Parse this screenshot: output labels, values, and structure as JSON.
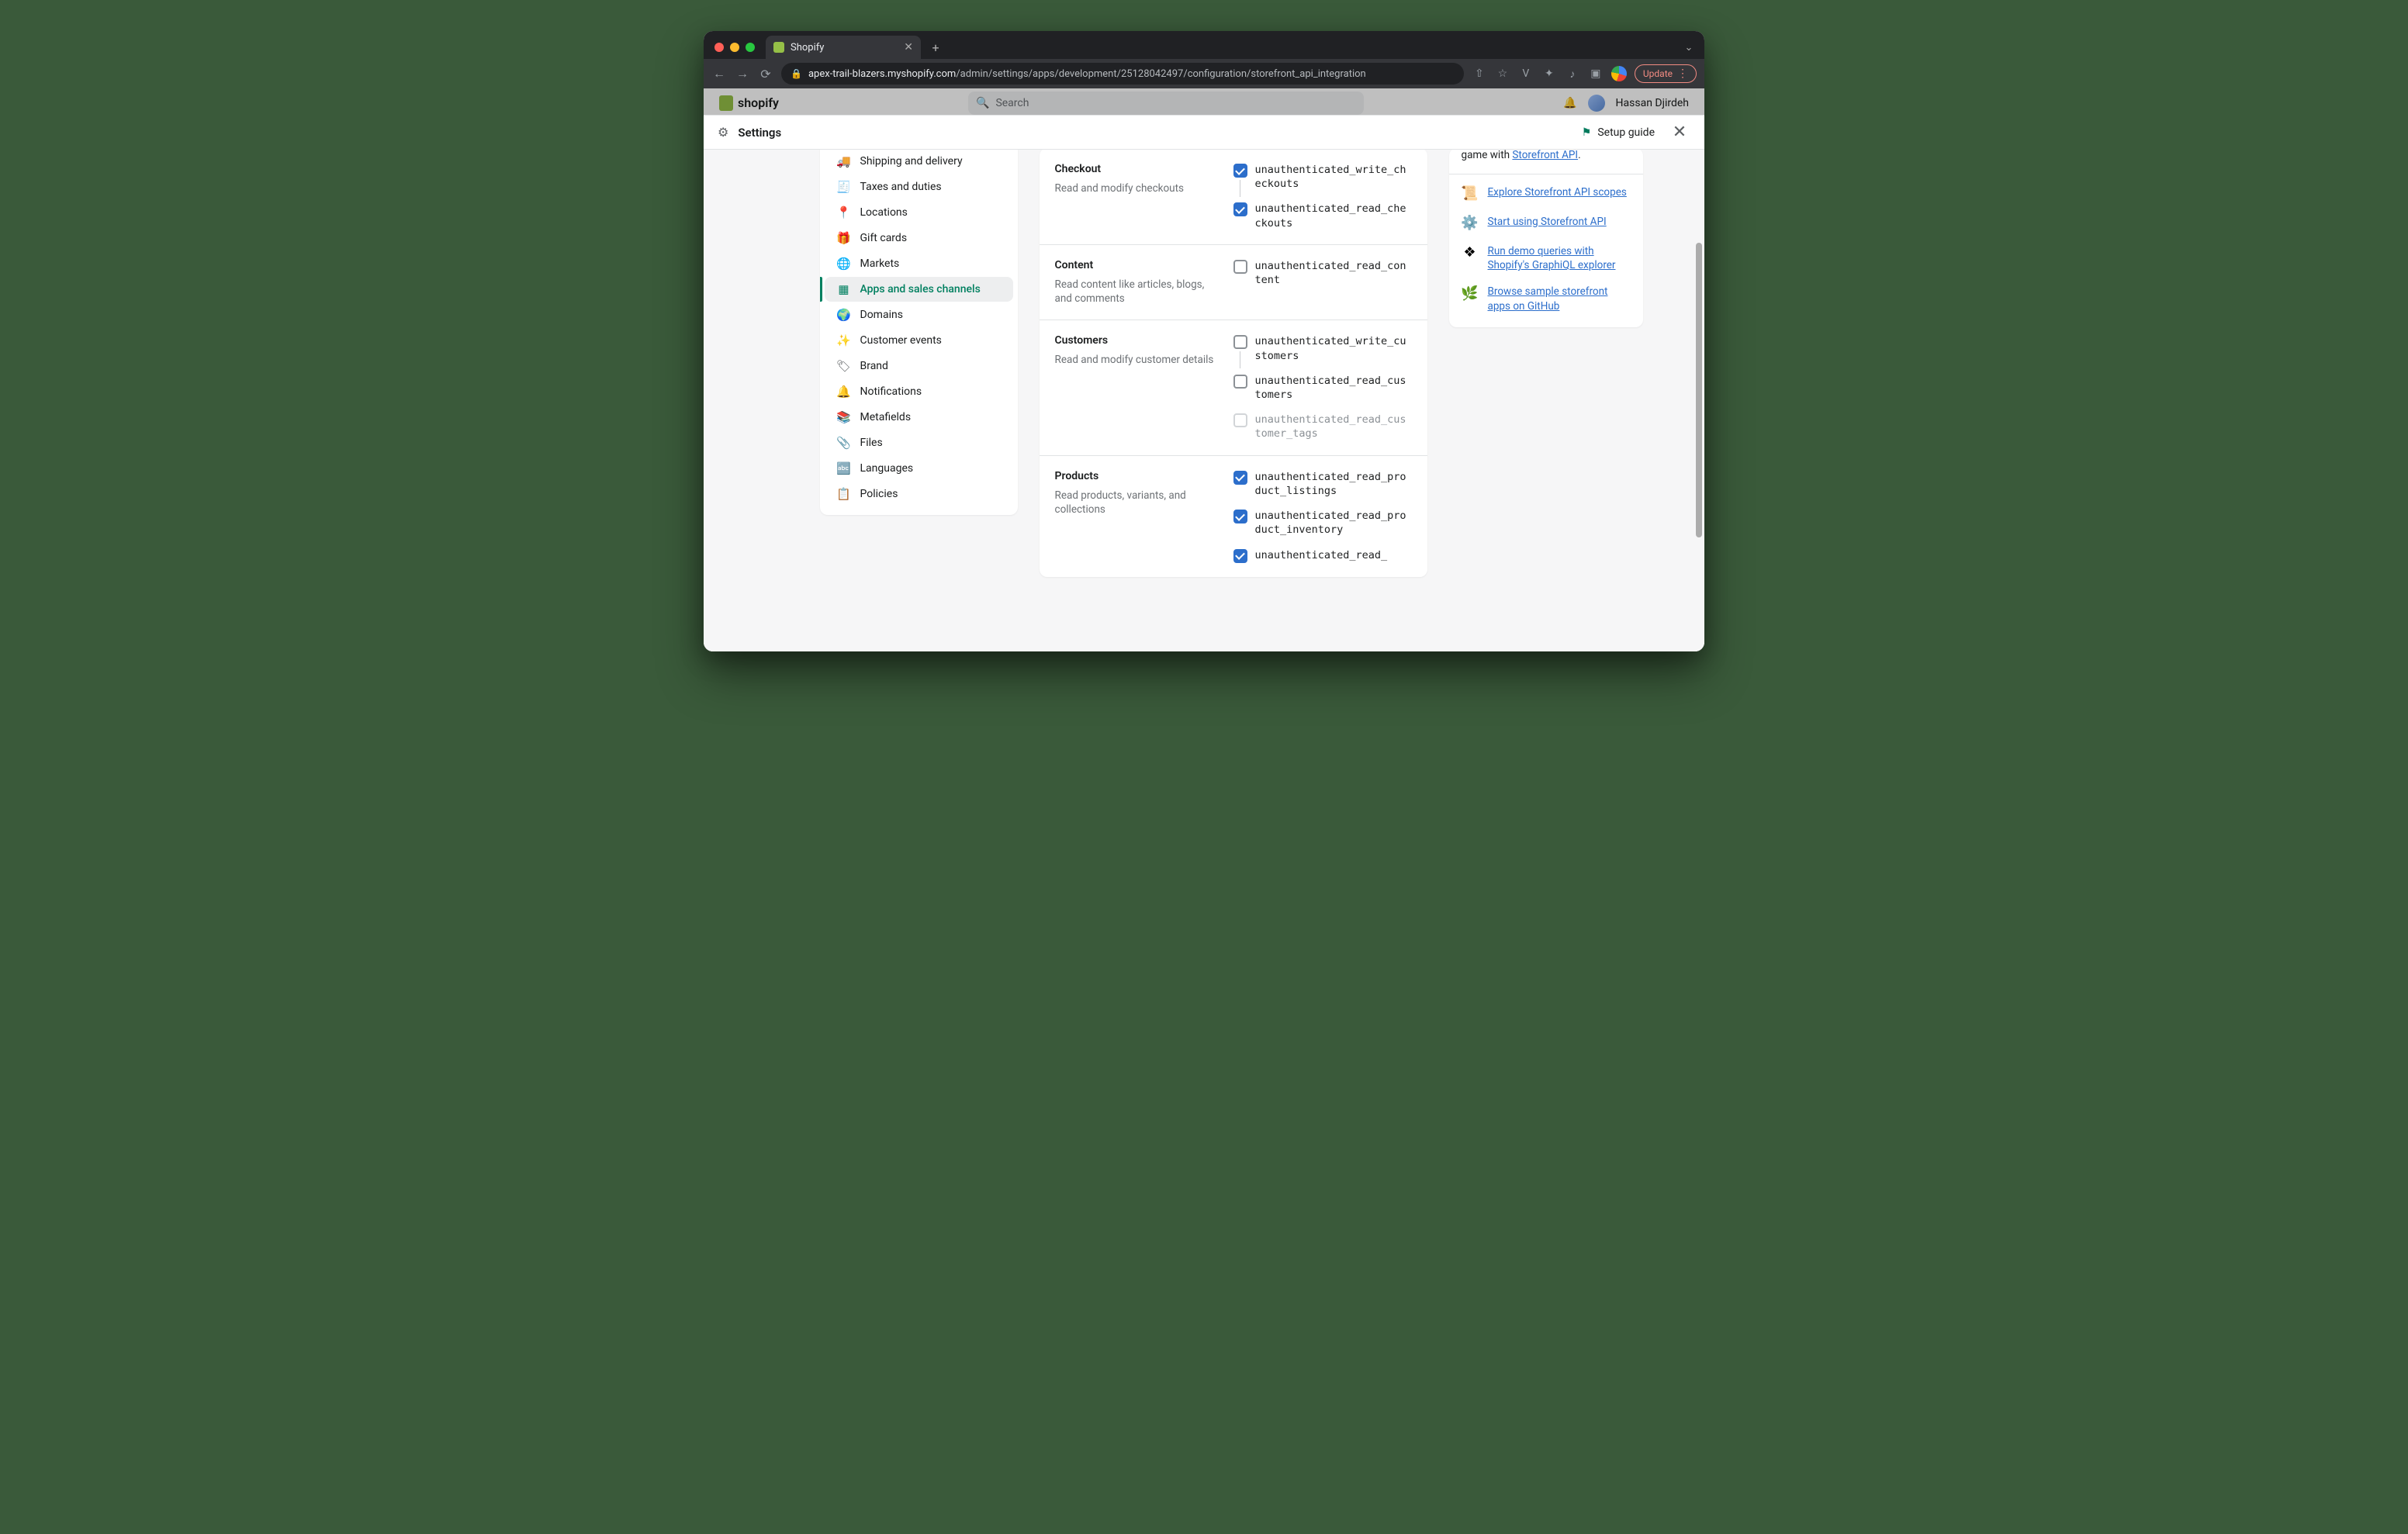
{
  "browser": {
    "tab_title": "Shopify",
    "new_tab_glyph": "+",
    "dropdown_glyph": "⌄",
    "back_glyph": "←",
    "forward_glyph": "→",
    "reload_glyph": "⟳",
    "lock_glyph": "🔒",
    "url_host": "apex-trail-blazers.myshopify.com",
    "url_path": "/admin/settings/apps/development/25128042497/configuration/storefront_api_integration",
    "share_glyph": "⇧",
    "star_glyph": "☆",
    "v_glyph": "V",
    "puzzle_glyph": "✦",
    "music_glyph": "♪",
    "square_glyph": "▣",
    "update_label": "Update"
  },
  "shopify_header": {
    "logo_text": "shopify",
    "search_placeholder": "Search",
    "search_glyph": "🔍",
    "bell_glyph": "🔔",
    "user_name": "Hassan Djirdeh"
  },
  "modal": {
    "gear_glyph": "⚙",
    "title": "Settings",
    "setup_flag_glyph": "⚑",
    "setup_label": "Setup guide",
    "close_glyph": "✕"
  },
  "sidebar": {
    "items": [
      {
        "icon": "🚚",
        "label": "Shipping and delivery"
      },
      {
        "icon": "🧾",
        "label": "Taxes and duties"
      },
      {
        "icon": "📍",
        "label": "Locations"
      },
      {
        "icon": "🎁",
        "label": "Gift cards"
      },
      {
        "icon": "🌐",
        "label": "Markets"
      },
      {
        "icon": "▦",
        "label": "Apps and sales channels"
      },
      {
        "icon": "🌍",
        "label": "Domains"
      },
      {
        "icon": "✨",
        "label": "Customer events"
      },
      {
        "icon": "🏷",
        "label": "Brand"
      },
      {
        "icon": "🔔",
        "label": "Notifications"
      },
      {
        "icon": "📚",
        "label": "Metafields"
      },
      {
        "icon": "📎",
        "label": "Files"
      },
      {
        "icon": "🔤",
        "label": "Languages"
      },
      {
        "icon": "📋",
        "label": "Policies"
      }
    ],
    "active_index": 5
  },
  "sections": [
    {
      "title": "Checkout",
      "desc": "Read and modify checkouts",
      "scopes": [
        {
          "label": "unauthenticated_write_checkouts",
          "checked": true,
          "link_after": true
        },
        {
          "label": "unauthenticated_read_checkouts",
          "checked": true
        }
      ]
    },
    {
      "title": "Content",
      "desc": "Read content like articles, blogs, and comments",
      "scopes": [
        {
          "label": "unauthenticated_read_content",
          "checked": false
        }
      ]
    },
    {
      "title": "Customers",
      "desc": "Read and modify customer details",
      "scopes": [
        {
          "label": "unauthenticated_write_customers",
          "checked": false,
          "link_after": true
        },
        {
          "label": "unauthenticated_read_customers",
          "checked": false
        },
        {
          "label": "unauthenticated_read_customer_tags",
          "checked": false,
          "disabled": true
        }
      ]
    },
    {
      "title": "Products",
      "desc": "Read products, variants, and collections",
      "scopes": [
        {
          "label": "unauthenticated_read_product_listings",
          "checked": true
        },
        {
          "label": "unauthenticated_read_product_inventory",
          "checked": true
        },
        {
          "label": "unauthenticated_read_",
          "checked": true
        }
      ]
    }
  ],
  "help": {
    "intro_prefix": "game with ",
    "intro_link": "Storefront API",
    "intro_suffix": ".",
    "links": [
      {
        "icon": "📜",
        "label": "Explore Storefront API scopes"
      },
      {
        "icon": "⚙️",
        "label": "Start using Storefront API"
      },
      {
        "icon": "❖",
        "label": "Run demo queries with Shopify's GraphiQL explorer"
      },
      {
        "icon": "🌿",
        "label": "Browse sample storefront apps on GitHub"
      }
    ]
  }
}
